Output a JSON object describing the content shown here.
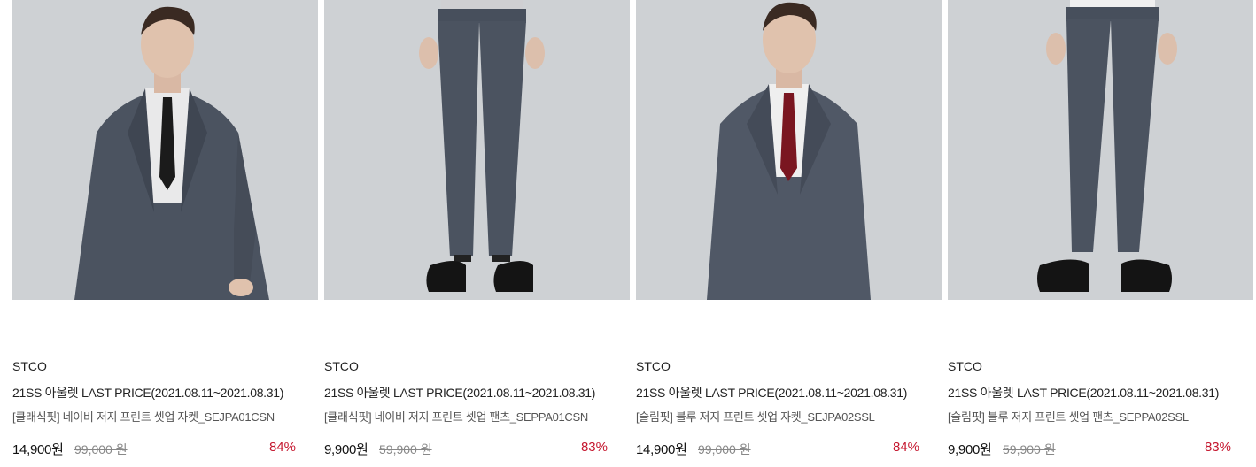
{
  "colors": {
    "accent": "#c5172f",
    "image_bg": "#ced1d4",
    "suit": "#4b5360"
  },
  "products": [
    {
      "image": {
        "kind": "jacket",
        "tie_color": "#1b1b1b"
      },
      "brand": "STCO",
      "title": "21SS 아울렛 LAST PRICE(2021.08.11~2021.08.31)",
      "name": "[클래식핏] 네이비 저지 프린트 셋업 자켓_SEJPA01CSN",
      "price": "14,900원",
      "original_price": "99,000 원",
      "discount": "84%"
    },
    {
      "image": {
        "kind": "pants"
      },
      "brand": "STCO",
      "title": "21SS 아울렛 LAST PRICE(2021.08.11~2021.08.31)",
      "name": "[클래식핏] 네이비 저지 프린트 셋업 팬츠_SEPPA01CSN",
      "price": "9,900원",
      "original_price": "59,900 원",
      "discount": "83%"
    },
    {
      "image": {
        "kind": "jacket",
        "tie_color": "#7a1620"
      },
      "brand": "STCO",
      "title": "21SS 아울렛 LAST PRICE(2021.08.11~2021.08.31)",
      "name": "[슬림핏] 블루 저지 프린트 셋업 자켓_SEJPA02SSL",
      "price": "14,900원",
      "original_price": "99,000 원",
      "discount": "84%"
    },
    {
      "image": {
        "kind": "pants"
      },
      "brand": "STCO",
      "title": "21SS 아울렛 LAST PRICE(2021.08.11~2021.08.31)",
      "name": "[슬림핏] 블루 저지 프린트 셋업 팬츠_SEPPA02SSL",
      "price": "9,900원",
      "original_price": "59,900 원",
      "discount": "83%"
    }
  ]
}
